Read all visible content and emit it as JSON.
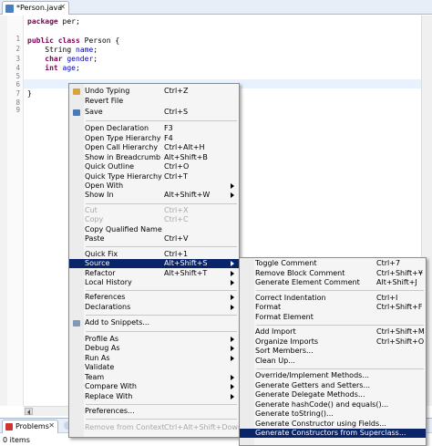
{
  "editor": {
    "tab_label": "*Person.java",
    "tab_close": "✕",
    "line_numbers": [
      "1",
      "2",
      "3",
      "4",
      "5",
      "6",
      "7",
      "8",
      "9"
    ],
    "code": {
      "l1_kw": "package",
      "l1_rest": " per;",
      "l3_kw1": "public",
      "l3_kw2": "class",
      "l3_rest": " Person {",
      "l4_type": "String",
      "l4_field": "name",
      "l4_end": ";",
      "l5_kw": "char",
      "l5_field": "gender",
      "l5_end": ";",
      "l6_kw": "int",
      "l6_field": "age",
      "l6_end": ";",
      "l9": "}"
    }
  },
  "bottom": {
    "problems_tab": "Problems",
    "tab_close": "✕",
    "items_count": "0 items"
  },
  "context_menu": {
    "items": [
      {
        "label": "Undo Typing",
        "shortcut": "Ctrl+Z"
      },
      {
        "label": "Revert File",
        "shortcut": ""
      },
      {
        "label": "Save",
        "shortcut": "Ctrl+S"
      },
      {
        "label": "Open Declaration",
        "shortcut": "F3"
      },
      {
        "label": "Open Type Hierarchy",
        "shortcut": "F4"
      },
      {
        "label": "Open Call Hierarchy",
        "shortcut": "Ctrl+Alt+H"
      },
      {
        "label": "Show in Breadcrumb",
        "shortcut": "Alt+Shift+B"
      },
      {
        "label": "Quick Outline",
        "shortcut": "Ctrl+O"
      },
      {
        "label": "Quick Type Hierarchy",
        "shortcut": "Ctrl+T"
      },
      {
        "label": "Open With",
        "shortcut": ""
      },
      {
        "label": "Show In",
        "shortcut": "Alt+Shift+W"
      },
      {
        "label": "Cut",
        "shortcut": "Ctrl+X"
      },
      {
        "label": "Copy",
        "shortcut": "Ctrl+C"
      },
      {
        "label": "Copy Qualified Name",
        "shortcut": ""
      },
      {
        "label": "Paste",
        "shortcut": "Ctrl+V"
      },
      {
        "label": "Quick Fix",
        "shortcut": "Ctrl+1"
      },
      {
        "label": "Source",
        "shortcut": "Alt+Shift+S"
      },
      {
        "label": "Refactor",
        "shortcut": "Alt+Shift+T"
      },
      {
        "label": "Local History",
        "shortcut": ""
      },
      {
        "label": "References",
        "shortcut": ""
      },
      {
        "label": "Declarations",
        "shortcut": ""
      },
      {
        "label": "Add to Snippets...",
        "shortcut": ""
      },
      {
        "label": "Profile As",
        "shortcut": ""
      },
      {
        "label": "Debug As",
        "shortcut": ""
      },
      {
        "label": "Run As",
        "shortcut": ""
      },
      {
        "label": "Validate",
        "shortcut": ""
      },
      {
        "label": "Team",
        "shortcut": ""
      },
      {
        "label": "Compare With",
        "shortcut": ""
      },
      {
        "label": "Replace With",
        "shortcut": ""
      },
      {
        "label": "Preferences...",
        "shortcut": ""
      },
      {
        "label": "Remove from Context",
        "shortcut": "Ctrl+Alt+Shift+Down"
      }
    ]
  },
  "source_submenu": {
    "items": [
      {
        "label": "Toggle Comment",
        "shortcut": "Ctrl+7"
      },
      {
        "label": "Remove Block Comment",
        "shortcut": "Ctrl+Shift+¥"
      },
      {
        "label": "Generate Element Comment",
        "shortcut": "Alt+Shift+J"
      },
      {
        "label": "Correct Indentation",
        "shortcut": "Ctrl+I"
      },
      {
        "label": "Format",
        "shortcut": "Ctrl+Shift+F"
      },
      {
        "label": "Format Element",
        "shortcut": ""
      },
      {
        "label": "Add Import",
        "shortcut": "Ctrl+Shift+M"
      },
      {
        "label": "Organize Imports",
        "shortcut": "Ctrl+Shift+O"
      },
      {
        "label": "Sort Members...",
        "shortcut": ""
      },
      {
        "label": "Clean Up...",
        "shortcut": ""
      },
      {
        "label": "Override/Implement Methods...",
        "shortcut": ""
      },
      {
        "label": "Generate Getters and Setters...",
        "shortcut": ""
      },
      {
        "label": "Generate Delegate Methods...",
        "shortcut": ""
      },
      {
        "label": "Generate hashCode() and equals()...",
        "shortcut": ""
      },
      {
        "label": "Generate toString()...",
        "shortcut": ""
      },
      {
        "label": "Generate Constructor using Fields...",
        "shortcut": ""
      },
      {
        "label": "Generate Constructors from Superclass...",
        "shortcut": ""
      }
    ]
  },
  "colors": {
    "selection": "#0a246a",
    "keyword": "#7f0055",
    "field": "#0000c0",
    "current_line": "#e8f2fe",
    "disabled_text": "#a8a8a8"
  },
  "icons": {
    "undo": "undo-arrow-icon",
    "save": "floppy-disk-icon",
    "snippets": "snippet-icon",
    "java_file": "java-file-icon",
    "problems": "problems-icon"
  }
}
